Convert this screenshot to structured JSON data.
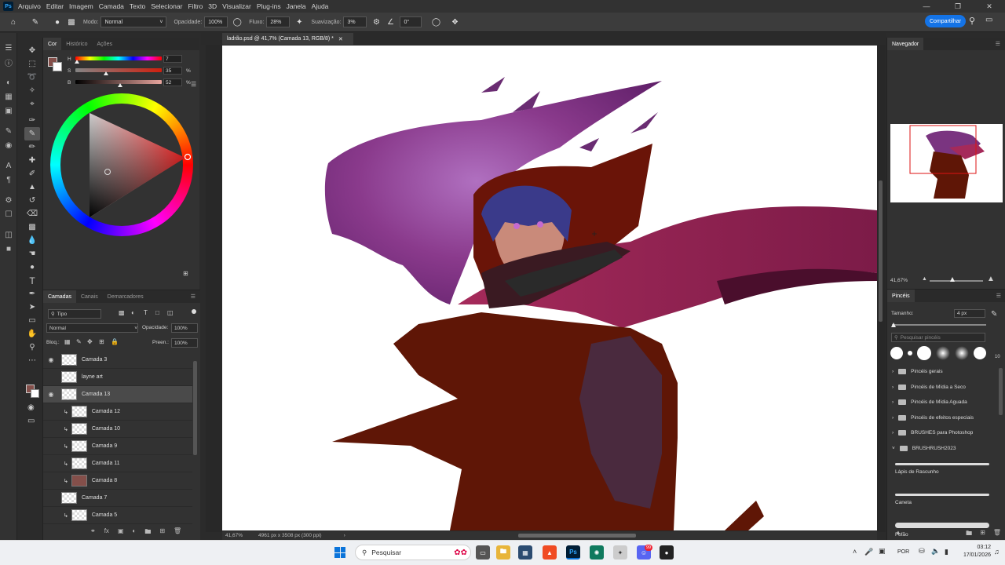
{
  "app": {
    "logo": "Ps",
    "menu": [
      "Arquivo",
      "Editar",
      "Imagem",
      "Camada",
      "Texto",
      "Selecionar",
      "Filtro",
      "3D",
      "Visualizar",
      "Plug-ins",
      "Janela",
      "Ajuda"
    ]
  },
  "options": {
    "mode_label": "Modo:",
    "mode_value": "Normal",
    "opacity_label": "Opacidade:",
    "opacity_value": "100%",
    "flow_label": "Fluxo:",
    "flow_value": "28%",
    "smoothing_label": "Suavização:",
    "smoothing_value": "3%",
    "angle_value": "0°",
    "share_label": "Compartilhar"
  },
  "color_panel": {
    "tabs": [
      "Cor",
      "Histórico",
      "Ações"
    ],
    "h_label": "H",
    "h_value": "7",
    "s_label": "S",
    "s_value": "35",
    "s_unit": "%",
    "b_label": "B",
    "b_value": "52",
    "b_unit": "%",
    "h_level": 0.02,
    "s_level": 0.35,
    "b_level": 0.52,
    "fg_color": "#844f4a",
    "bg_color": "#ffffff"
  },
  "layers_panel": {
    "tabs": [
      "Camadas",
      "Canais",
      "Demarcadores"
    ],
    "filter_value": "Tipo",
    "blend_value": "Normal",
    "opacity_label": "Opacidade:",
    "opacity_value": "100%",
    "lock_label": "Bloq.:",
    "fill_label": "Preen.:",
    "fill_value": "100%",
    "layers": [
      {
        "name": "Camada 3",
        "visible": true,
        "clipped": false,
        "selected": false
      },
      {
        "name": "layne art",
        "visible": false,
        "clipped": false,
        "selected": false
      },
      {
        "name": "Camada 13",
        "visible": true,
        "clipped": false,
        "selected": true
      },
      {
        "name": "Camada 12",
        "visible": false,
        "clipped": true,
        "selected": false
      },
      {
        "name": "Camada 10",
        "visible": false,
        "clipped": true,
        "selected": false
      },
      {
        "name": "Camada 9",
        "visible": false,
        "clipped": true,
        "selected": false
      },
      {
        "name": "Camada 11",
        "visible": false,
        "clipped": true,
        "selected": false
      },
      {
        "name": "Camada 8",
        "visible": false,
        "clipped": true,
        "selected": false
      },
      {
        "name": "Camada 7",
        "visible": false,
        "clipped": false,
        "selected": false
      },
      {
        "name": "Camada 5",
        "visible": false,
        "clipped": true,
        "selected": false
      }
    ]
  },
  "document": {
    "tab_title": "ladrão.psd @ 41,7% (Camada 13, RGB/8) *",
    "zoom": "41,67%",
    "size_info": "4961 px x 3508 px (300 ppi)"
  },
  "navigator": {
    "title": "Navegador",
    "zoom": "41,67%"
  },
  "brushes": {
    "title": "Pincéis",
    "size_label": "Tamanho:",
    "size_value": "4 px",
    "search_placeholder": "Pesquisar pincéis",
    "preset_count": "10",
    "folders": [
      "Pincéis gerais",
      "Pincéis de Mídia a Seco",
      "Pincéis de Mídia Aguada",
      "Pincéis de efeitos especiais",
      "BRUSHES para Photoshop",
      "BRUSHRUSH2023"
    ],
    "items": [
      "Lápis de Rascunho",
      "Caneta",
      "Fofão"
    ]
  },
  "taskbar": {
    "search_label": "Pesquisar",
    "lang": "POR",
    "time": "03:12",
    "date": "17/01/2026",
    "discord_badge": "99"
  }
}
